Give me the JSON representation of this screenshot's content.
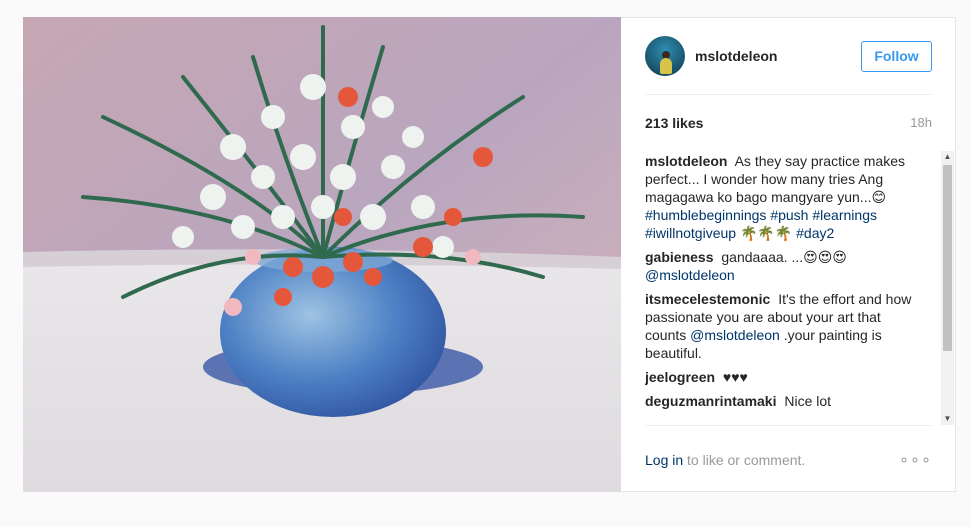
{
  "post": {
    "username": "mslotdeleon",
    "follow_label": "Follow",
    "likes": "213 likes",
    "time": "18h"
  },
  "comments": [
    {
      "user": "mslotdeleon",
      "text": "As they say practice makes perfect... I wonder how many tries Ang magagawa ko bago mangyare yun...😊",
      "tags": [
        "#humblebeginnings",
        "#push",
        "#learnings",
        "#iwillnotgiveup"
      ],
      "emoji": "🌴🌴🌴",
      "last_tag": "#day2"
    },
    {
      "user": "gabieness",
      "text": "gandaaaa. ...😍😍😍",
      "mention": "@mslotdeleon"
    },
    {
      "user": "itsmecelestemonic",
      "text_a": "It's the effort and how passionate you are about your art that counts",
      "mention": "@mslotdeleon",
      "text_b": ".your painting is beautiful."
    },
    {
      "user": "jeelogreen",
      "text": "♥♥♥"
    },
    {
      "user": "deguzmanrintamaki",
      "text": "Nice lot"
    }
  ],
  "footer": {
    "login_label": "Log in",
    "rest_label": " to like or comment.",
    "more_label": "∘∘∘"
  },
  "scrollbar": {
    "up": "▲",
    "down": "▼"
  },
  "icons": {
    "avatar": "profile-photo",
    "more": "more-options-icon"
  }
}
